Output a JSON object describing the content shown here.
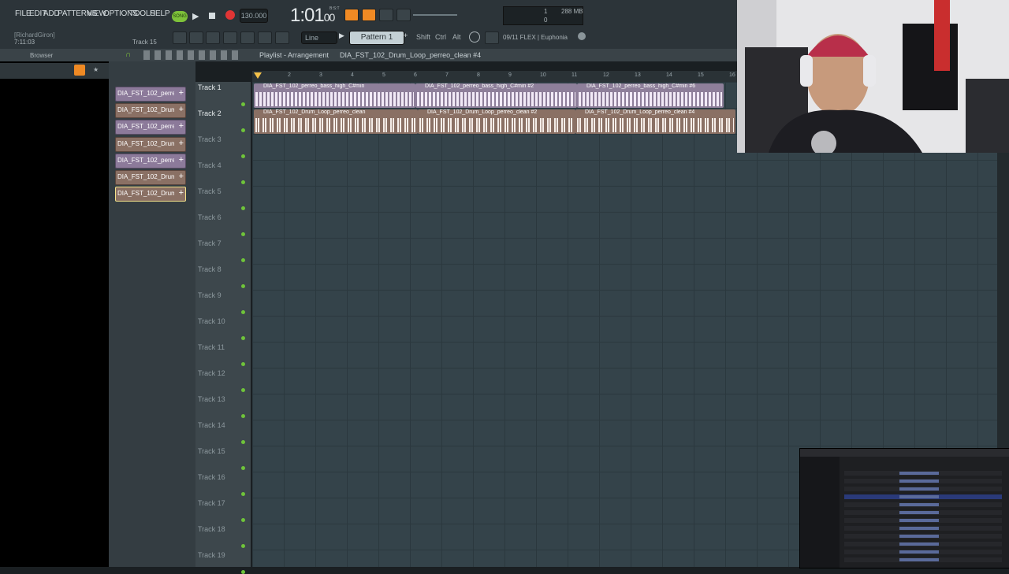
{
  "menu": [
    "FILE",
    "EDIT",
    "ADD",
    "PATTERNS",
    "VIEW",
    "OPTIONS",
    "TOOLS",
    "HELP"
  ],
  "transport": {
    "mode_label": "SONG",
    "tempo": "130.000",
    "time": "1:01",
    "time_small": "00",
    "time_caption": "B:S:T"
  },
  "cpu": {
    "a": "1",
    "b": "0",
    "mem": "288 MB"
  },
  "hint_user": "[RichardGiron]",
  "hint_time": "7:11:03",
  "hint_track": "Track 15",
  "snap": "Line",
  "pattern": "Pattern 1",
  "keys": [
    "Shift",
    "Ctrl",
    "Alt"
  ],
  "news": "09/11  FLEX | Euphonia",
  "browser_label": "Browser",
  "playlist": {
    "title": "Playlist - Arrangement",
    "breadcrumb": "DIA_FST_102_Drum_Loop_perreo_clean #4"
  },
  "channels": [
    {
      "label": "DIA_FST_102_perreo..."
    },
    {
      "label": "DIA_FST_102_Drum_..."
    },
    {
      "label": "DIA_FST_102_perreo..."
    },
    {
      "label": "DIA_FST_102_Drum_..."
    },
    {
      "label": "DIA_FST_102_perreo..."
    },
    {
      "label": "DIA_FST_102_Drum_..."
    },
    {
      "label": "DIA_FST_102_Drum_..."
    }
  ],
  "tracks": [
    "Track 1",
    "Track 2",
    "Track 3",
    "Track 4",
    "Track 5",
    "Track 6",
    "Track 7",
    "Track 8",
    "Track 9",
    "Track 10",
    "Track 11",
    "Track 12",
    "Track 13",
    "Track 14",
    "Track 15",
    "Track 16",
    "Track 17",
    "Track 18",
    "Track 19"
  ],
  "ruler": [
    "2",
    "3",
    "4",
    "5",
    "6",
    "7",
    "8",
    "9",
    "10",
    "11",
    "12",
    "13",
    "14",
    "15",
    "16"
  ],
  "clips": {
    "bass": [
      "DIA_FST_102_perreo_bass_high_C#min",
      "DIA_FST_102_perreo_bass_high_C#min #2",
      "DIA_FST_102_perreo_bass_high_C#min #6"
    ],
    "drum": [
      "DIA_FST_102_Drum_Loop_perreo_clean",
      "DIA_FST_102_Drum_Loop_perreo_clean #2",
      "DIA_FST_102_Drum_Loop_perreo_clean #4"
    ]
  },
  "colors": {
    "bass_clip": "#8e7f9a",
    "drum_clip": "#8a7064",
    "accent": "#f08a24",
    "grid": "#34434a"
  }
}
